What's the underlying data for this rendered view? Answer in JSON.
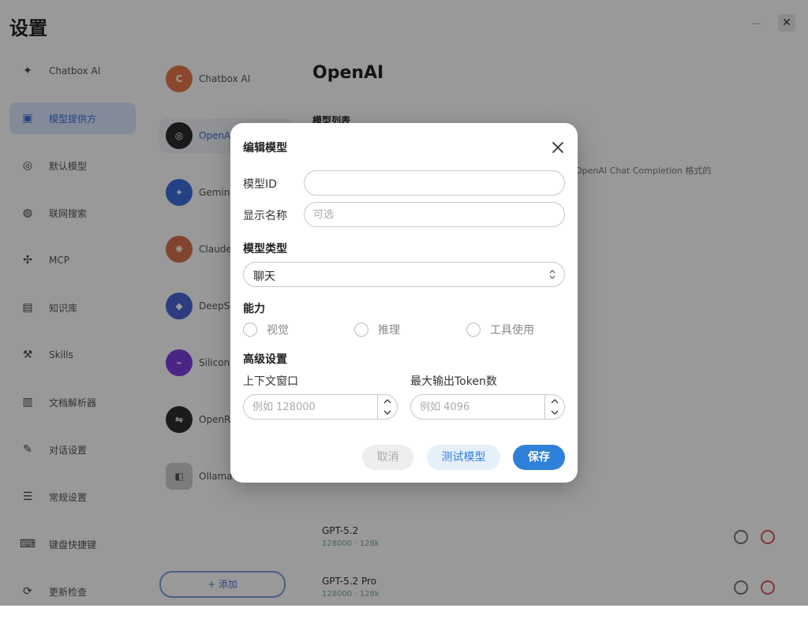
{
  "background": {
    "page_title": "设置",
    "window_min": "—",
    "window_close": "✕",
    "nav": [
      {
        "label": "Chatbox AI",
        "icon": "chatbox-icon"
      },
      {
        "label": "模型提供方",
        "icon": "model-provider-icon",
        "active": true
      },
      {
        "label": "默认模型",
        "icon": "default-model-icon"
      },
      {
        "label": "联网搜索",
        "icon": "web-search-icon"
      },
      {
        "label": "MCP",
        "icon": "mcp-icon"
      },
      {
        "label": "知识库",
        "icon": "knowledge-base-icon"
      },
      {
        "label": "Skills",
        "icon": "skills-icon"
      },
      {
        "label": "文档解析器",
        "icon": "document-parser-icon"
      },
      {
        "label": "对话设置",
        "icon": "chat-settings-icon"
      },
      {
        "label": "常规设置",
        "icon": "general-settings-icon"
      },
      {
        "label": "键盘快捷键",
        "icon": "keyboard-icon"
      },
      {
        "label": "更新检查",
        "icon": "update-icon"
      }
    ],
    "providers": [
      {
        "label": "Chatbox AI",
        "color": "#e8774a"
      },
      {
        "label": "OpenAI",
        "color": "#2a2a2a",
        "active": true
      },
      {
        "label": "Gemini",
        "color": "#3b6fe0"
      },
      {
        "label": "Claude",
        "color": "#d9704a"
      },
      {
        "label": "DeepSeek",
        "color": "#4b63d8"
      },
      {
        "label": "SiliconFlow",
        "color": "#7a3fe0"
      },
      {
        "label": "OpenRouter",
        "color": "#2e2e2e"
      },
      {
        "label": "Ollama",
        "color": "#cfcfcf"
      }
    ],
    "add_label": "+ 添加",
    "detail_title": "OpenAI",
    "detail_sub": "模型列表",
    "detail_desc": "，支持OpenAI Chat Completion 格式的",
    "models": [
      {
        "name": "GPT-5.2",
        "tags": "128000 · 128k"
      },
      {
        "name": "GPT-5.2 Pro",
        "tags": "128000 · 128k"
      }
    ]
  },
  "modal": {
    "title": "编辑模型",
    "model_id_label": "模型ID",
    "model_id_value": "",
    "display_name_label": "显示名称",
    "display_name_placeholder": "可选",
    "model_type_label": "模型类型",
    "model_type_value": "聊天",
    "capabilities_label": "能力",
    "capabilities": [
      "视觉",
      "推理",
      "工具使用"
    ],
    "advanced_label": "高级设置",
    "context_window_label": "上下文窗口",
    "context_window_placeholder": "例如 128000",
    "max_output_label": "最大输出Token数",
    "max_output_placeholder": "例如 4096",
    "cancel_label": "取消",
    "test_label": "测试模型",
    "save_label": "保存"
  }
}
